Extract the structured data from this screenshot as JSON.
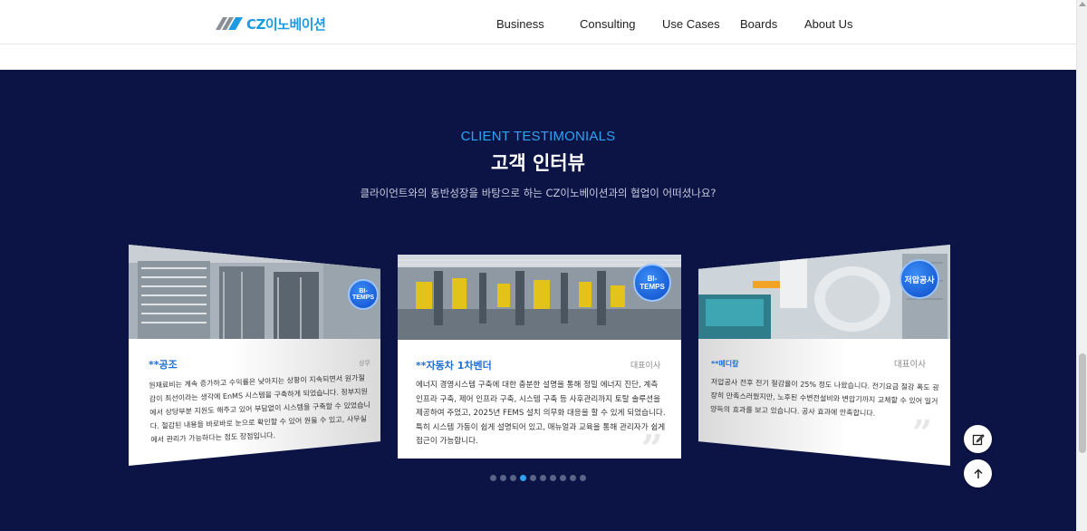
{
  "header": {
    "logo_text": "CZ이노베이션",
    "nav": [
      {
        "label": "Business"
      },
      {
        "label": "Consulting"
      },
      {
        "label": "Use Cases"
      },
      {
        "label": "Boards"
      },
      {
        "label": "About Us"
      }
    ]
  },
  "section": {
    "eyebrow": "CLIENT TESTIMONIALS",
    "title": "고객 인터뷰",
    "subtitle": "클라이언트와의 동반성장을 바탕으로 하는 CZ이노베이션과의 협업이 어떠셨나요?"
  },
  "testimonials": [
    {
      "badge": "BI-TEMPS",
      "name": "**공조",
      "role": "상무",
      "body": "원재료비는 계속 증가하고 수익률은 낮아지는 상황이 지속되면서 원가절감이 최선이라는 생각에 EnMS 시스템을 구축하게 되었습니다. 정부지원에서 상당부분 지원도 해주고 있어 부담없이 시스템을 구축할 수 있었습니다. 절감된 내용을 바로바로 눈으로 확인할 수 있어 원을 수 있고, 사무실에서 관리가 가능하다는 점도 장점입니다."
    },
    {
      "badge": "BI-TEMPS",
      "name": "**자동차 1차벤더",
      "role": "대표이사",
      "body": "에너지 경영시스템 구축에 대한 충분한 설명을 통해 정밀 에너지 진단, 계측 인프라 구축, 제어 인프라 구축, 시스템 구축 등 사후관리까지 토탈 솔루션을 제공하여 주었고, 2025년 FEMS 설치 의무화 대응을 할 수 있게 되었습니다. 특히 시스템 가동이 쉽게 설명되어 있고, 매뉴얼과 교육을 통해 관리자가 쉽게 접근이 가능합니다."
    },
    {
      "badge": "저압공사",
      "name": "**메디칼",
      "role": "대표이사",
      "body": "저압공사 전후 전기 절감율이 25% 정도 나왔습니다. 전기요금 절감 폭도 굉장히 만족스러웠지만, 노후된 수변전설비와 변압기까지 교체할 수 있어 일거양득의 효과를 보고 있습니다. 공사 효과에 만족합니다."
    }
  ],
  "pagination": {
    "count": 10,
    "active_index": 3
  },
  "fab": {
    "edit_icon": "edit-icon",
    "top_icon": "arrow-up-icon"
  },
  "colors": {
    "accent": "#2ea3f2",
    "background": "#0b1445",
    "name": "#1e6fd0",
    "badge": "#0b4bc8"
  }
}
